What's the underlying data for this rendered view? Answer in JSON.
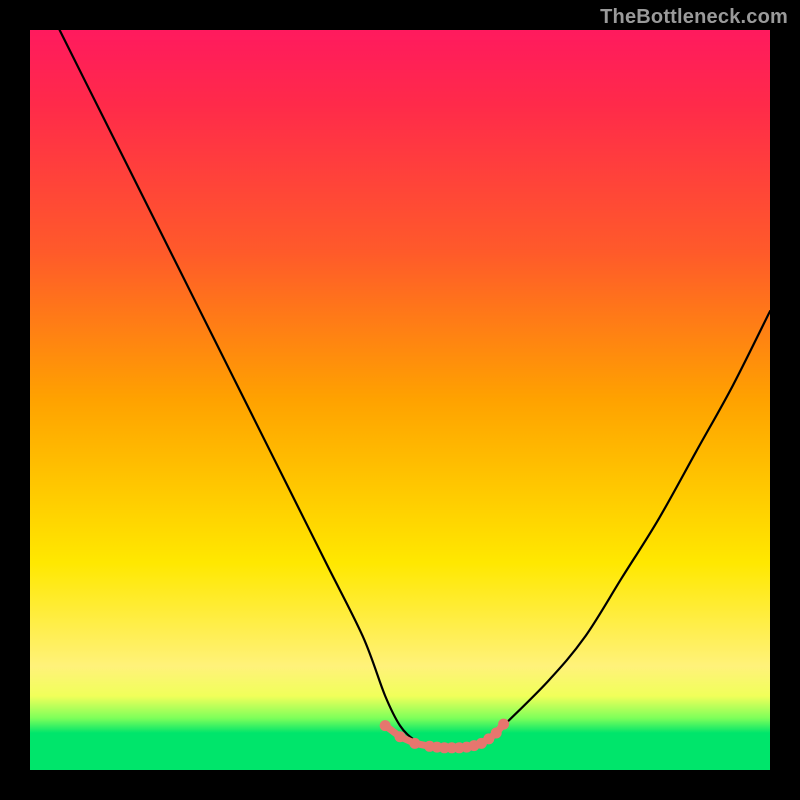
{
  "watermark": "TheBottleneck.com",
  "chart_data": {
    "type": "line",
    "title": "",
    "xlabel": "",
    "ylabel": "",
    "xlim": [
      0,
      100
    ],
    "ylim": [
      0,
      100
    ],
    "grid": false,
    "legend": false,
    "series": [
      {
        "name": "bottleneck-curve",
        "x": [
          4,
          10,
          15,
          20,
          25,
          30,
          35,
          40,
          45,
          48,
          50,
          52,
          54,
          56,
          58,
          60,
          62,
          64,
          70,
          75,
          80,
          85,
          90,
          95,
          100
        ],
        "y": [
          100,
          88,
          78,
          68,
          58,
          48,
          38,
          28,
          18,
          10,
          6,
          4,
          3,
          3,
          3,
          3.5,
          4,
          6,
          12,
          18,
          26,
          34,
          43,
          52,
          62
        ]
      }
    ],
    "markers": {
      "name": "valley-highlight",
      "color": "#e6766e",
      "x": [
        48,
        50,
        52,
        54,
        55,
        56,
        57,
        58,
        59,
        60,
        61,
        62,
        63,
        64
      ],
      "y": [
        6,
        4.5,
        3.6,
        3.2,
        3.1,
        3.0,
        3.0,
        3.0,
        3.1,
        3.3,
        3.6,
        4.2,
        5.0,
        6.2
      ]
    },
    "gradient_stops": [
      {
        "pos": 0,
        "color": "#ff1a5e"
      },
      {
        "pos": 10,
        "color": "#ff2a4a"
      },
      {
        "pos": 30,
        "color": "#ff5a2a"
      },
      {
        "pos": 50,
        "color": "#ffa200"
      },
      {
        "pos": 72,
        "color": "#ffe800"
      },
      {
        "pos": 86,
        "color": "#fff27a"
      },
      {
        "pos": 90,
        "color": "#f1ff5a"
      },
      {
        "pos": 93,
        "color": "#7dff5a"
      },
      {
        "pos": 95,
        "color": "#00e56b"
      },
      {
        "pos": 100,
        "color": "#00e56b"
      }
    ]
  }
}
